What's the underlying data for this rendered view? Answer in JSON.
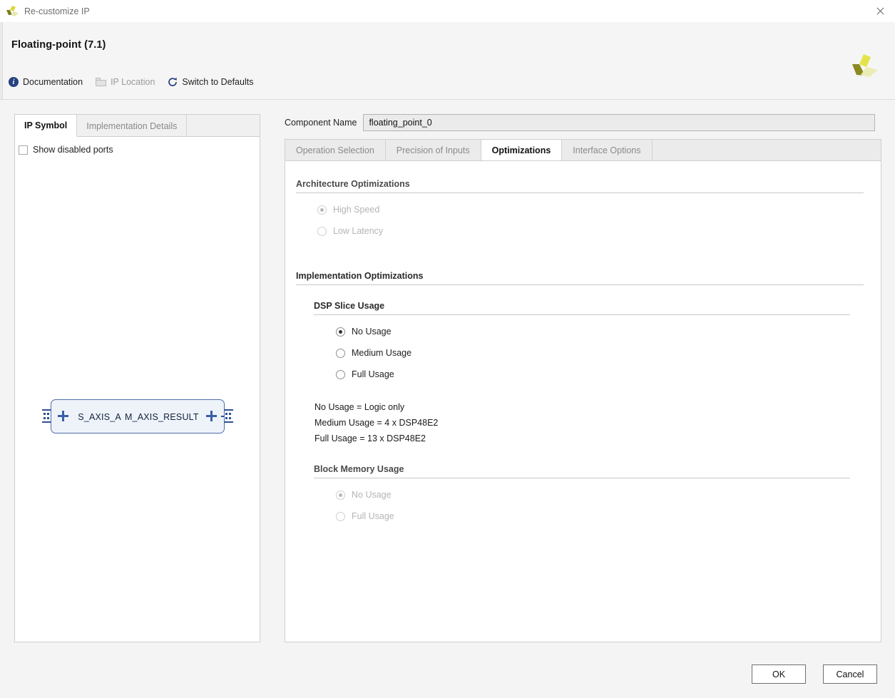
{
  "window": {
    "title": "Re-customize IP",
    "logo_icon": "xilinx-logo-icon",
    "close_icon": "close-icon"
  },
  "header": {
    "ip_title": "Floating-point (7.1)",
    "brand_logo_icon": "xilinx-pinwheel-logo-icon",
    "toolbar": [
      {
        "label": "Documentation",
        "icon": "info-icon",
        "enabled": true
      },
      {
        "label": "IP Location",
        "icon": "folder-icon",
        "enabled": false
      },
      {
        "label": "Switch to Defaults",
        "icon": "refresh-icon",
        "enabled": true
      }
    ]
  },
  "left_panel": {
    "tabs": [
      {
        "label": "IP Symbol",
        "active": true
      },
      {
        "label": "Implementation Details",
        "active": false
      }
    ],
    "show_disabled_ports": {
      "label": "Show disabled ports",
      "checked": false
    },
    "symbol": {
      "input_port": "S_AXIS_A",
      "output_port": "M_AXIS_RESULT",
      "expand_icon": "plus-icon",
      "bus_icon": "bus-connector-icon"
    }
  },
  "right_panel": {
    "component_name_label": "Component Name",
    "component_name_value": "floating_point_0",
    "tabs": [
      {
        "label": "Operation Selection",
        "active": false
      },
      {
        "label": "Precision of Inputs",
        "active": false
      },
      {
        "label": "Optimizations",
        "active": true
      },
      {
        "label": "Interface Options",
        "active": false
      }
    ],
    "architecture": {
      "section_title": "Architecture Optimizations",
      "options": [
        {
          "label": "High Speed",
          "checked": true,
          "enabled": false
        },
        {
          "label": "Low Latency",
          "checked": false,
          "enabled": false
        }
      ]
    },
    "implementation": {
      "section_title": "Implementation Optimizations",
      "dsp": {
        "section_title": "DSP Slice Usage",
        "options": [
          {
            "label": "No Usage",
            "checked": true,
            "enabled": true
          },
          {
            "label": "Medium Usage",
            "checked": false,
            "enabled": true
          },
          {
            "label": "Full Usage",
            "checked": false,
            "enabled": true
          }
        ],
        "notes": [
          "No Usage = Logic only",
          "Medium Usage = 4 x DSP48E2",
          "Full Usage = 13 x DSP48E2"
        ]
      },
      "block_memory": {
        "section_title": "Block Memory Usage",
        "options": [
          {
            "label": "No Usage",
            "checked": true,
            "enabled": false
          },
          {
            "label": "Full Usage",
            "checked": false,
            "enabled": false
          }
        ]
      }
    }
  },
  "footer": {
    "ok_label": "OK",
    "cancel_label": "Cancel"
  },
  "colors": {
    "accent_blue": "#26417f",
    "logo_yellow": "#e6e64b",
    "logo_olive": "#8a8a1e",
    "logo_pale": "#e8ecb0",
    "symbol_border": "#4f6fa8",
    "symbol_fill": "#eef3fa"
  }
}
